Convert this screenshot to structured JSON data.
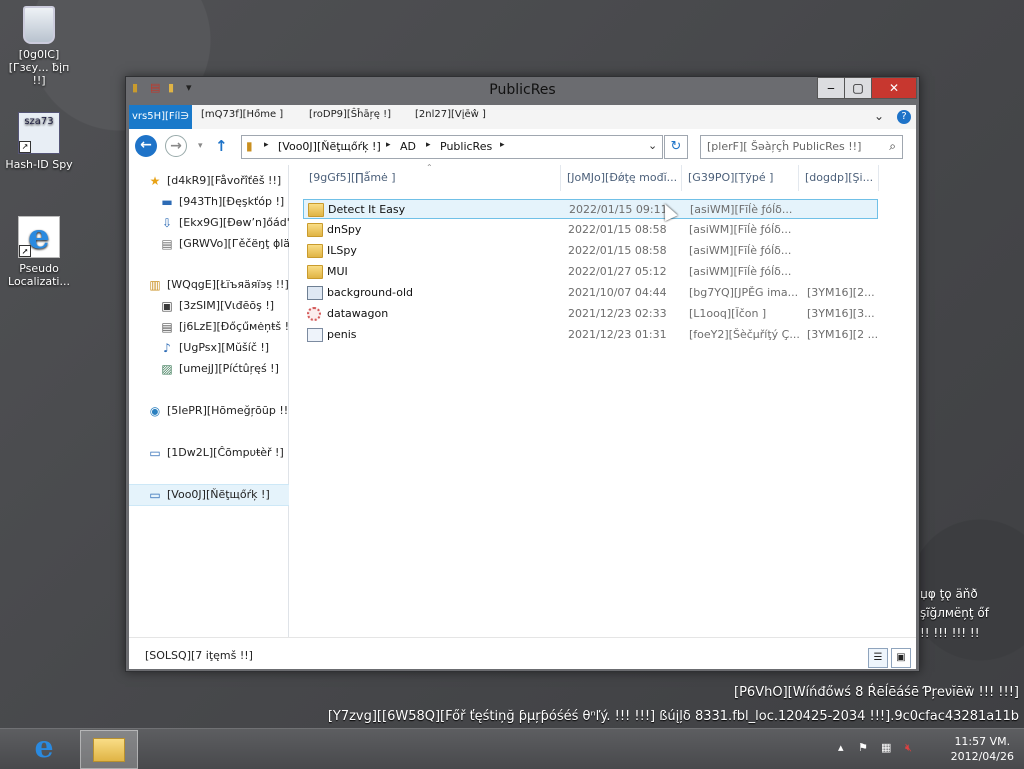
{
  "desktop": {
    "icons": [
      {
        "label": "[0g0IC][Гзєу... ƀįп !!]",
        "icon": "recycle-bin-icon"
      },
      {
        "label": "Hash-ID Spy",
        "icon": "hash-id-spy-icon",
        "glyph": "sza73"
      },
      {
        "label": "Pseudo Localizati...",
        "icon": "internet-explorer-icon"
      }
    ],
    "watermark": {
      "line1": "[P6VhO][Wíńđőwś 8 Ŕēĺēáśē Ƥŗеνĭēẅ !!! !!!]",
      "line2": "[Y7zvg][[6W58Q][Főř ťęśtiņğ ƥµŗƥóśéś θⁿľý. !!! !!!] ßúįļδ 8331.fbl_loc.120425-2034 !!!].9c0cfac43281a11b"
    },
    "right_edge_text": [
      "џφ ţǫ äňð",
      "şĩğлмёņţ őf",
      "!! !!! !!! !!"
    ]
  },
  "window": {
    "title": "PublicRes",
    "ribbon": {
      "file_tab": "vrs5H][Fíl∋",
      "tabs": [
        "[mQ73f][Hőme ]",
        "[roDP9][Ŝĥāŗę !]",
        "[2nl27][Vįēŵ ]"
      ]
    },
    "address": {
      "crumbs": [
        "[Voo0J][Ňẽţщőŕķ !]",
        "AD",
        "PublicRes"
      ]
    },
    "search": {
      "placeholder": "[plerF][ Šəàŗçĥ PublicRes !!]"
    },
    "nav": [
      {
        "label": "[d4kR9][Fåvořîťēš !!]",
        "icon": "favorites-star-icon",
        "glyph": "★",
        "color": "#e8a317",
        "indent": 0,
        "group": "favorites"
      },
      {
        "label": "[943Th][Ðęşkťóp !]",
        "icon": "desktop-icon",
        "glyph": "▭",
        "color": "#2d6bb5",
        "indent": 1
      },
      {
        "label": "[Ekx9G][Ðɵwʼn]őád'ş",
        "icon": "downloads-icon",
        "glyph": "⇩",
        "color": "#2d6bb5",
        "indent": 1
      },
      {
        "label": "[GRWVo][Гěčëŋţ ɸlä",
        "icon": "recent-places-icon",
        "glyph": "▤",
        "color": "#6b6b6b",
        "indent": 1
      },
      {
        "label": "[WQqgE][Łїъяäяïэş !!]",
        "icon": "libraries-icon",
        "glyph": "▥",
        "color": "#c98f20",
        "indent": 0,
        "group": "libraries"
      },
      {
        "label": "[3zSIM][Vιđēōş !]",
        "icon": "videos-icon",
        "glyph": "▣",
        "color": "#3b3b3b",
        "indent": 1
      },
      {
        "label": "[j6LzE][Ðőçűмėņŧš !",
        "icon": "documents-icon",
        "glyph": "▤",
        "color": "#555",
        "indent": 1
      },
      {
        "label": "[UgPsx][Mŭšíč !]",
        "icon": "music-icon",
        "glyph": "♪",
        "color": "#2d6bb5",
        "indent": 1
      },
      {
        "label": "[umejJ][Píćtûŗęś !]",
        "icon": "pictures-icon",
        "glyph": "▨",
        "color": "#3b7a57",
        "indent": 1
      },
      {
        "label": "[5IePR][Hōmeğŗōūp !!]",
        "icon": "homegroup-icon",
        "glyph": "◉",
        "color": "#2a7fbf",
        "indent": 0,
        "group": "homegroup"
      },
      {
        "label": "[1Dw2L][Ĉõmpυŧèř !]",
        "icon": "computer-icon",
        "glyph": "▭",
        "color": "#2d6bb5",
        "indent": 0,
        "group": "computer"
      },
      {
        "label": "[Voo0J][Ňẽţщőŕķ !]",
        "icon": "network-icon",
        "glyph": "▭",
        "color": "#2d6bb5",
        "indent": 0,
        "group": "network",
        "selected": true
      }
    ],
    "columns": [
      "[9gGf5][∏ǻmė ]",
      "[JoMJo][Ðǿţę mоđĭ...",
      "[G39PO][Ţÿpé ]",
      "[dogdp][Şi..."
    ],
    "files": [
      {
        "name": "Detect It Easy",
        "date": "2022/01/15 09:11",
        "type": "[asiWM][Fīĺè ƒóĺδ...",
        "size": "",
        "kind": "folder",
        "hover": true
      },
      {
        "name": "dnSpy",
        "date": "2022/01/15 08:58",
        "type": "[asiWM][Fīĺè ƒóĺδ...",
        "size": "",
        "kind": "folder"
      },
      {
        "name": "ILSpy",
        "date": "2022/01/15 08:58",
        "type": "[asiWM][Fīĺè ƒóĺδ...",
        "size": "",
        "kind": "folder"
      },
      {
        "name": "MUI",
        "date": "2022/01/27 05:12",
        "type": "[asiWM][Fīĺè ƒóĺδ...",
        "size": "",
        "kind": "folder"
      },
      {
        "name": "background-old",
        "date": "2021/10/07 04:44",
        "type": "[bg7YQ][JΡĚG ima...",
        "size": "[3YM16][2...",
        "kind": "image"
      },
      {
        "name": "datawagon",
        "date": "2021/12/23 02:33",
        "type": "[L1ooq][Ĭčon ]",
        "size": "[3YM16][3...",
        "kind": "icon"
      },
      {
        "name": "penis",
        "date": "2021/12/23 01:31",
        "type": "[foeY2][Šèčµříţý Ç...",
        "size": "[3YM16][2 ...",
        "kind": "cert"
      }
    ],
    "status": "[SOLSQ][7 іţęmš !!]"
  },
  "taskbar": {
    "clock_time": "11:57 VM.",
    "clock_date": "2012/04/26"
  }
}
